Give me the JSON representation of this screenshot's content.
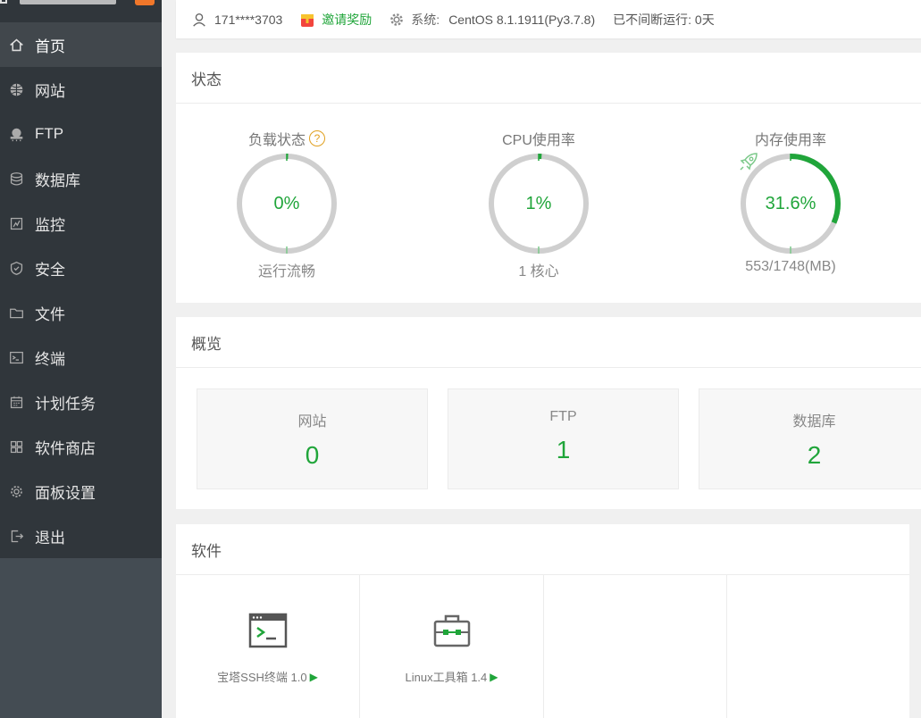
{
  "sidebar": {
    "items": [
      {
        "label": "首页",
        "icon": "home-icon"
      },
      {
        "label": "网站",
        "icon": "globe-icon"
      },
      {
        "label": "FTP",
        "icon": "ftp-icon"
      },
      {
        "label": "数据库",
        "icon": "database-icon"
      },
      {
        "label": "监控",
        "icon": "monitor-icon"
      },
      {
        "label": "安全",
        "icon": "shield-icon"
      },
      {
        "label": "文件",
        "icon": "folder-icon"
      },
      {
        "label": "终端",
        "icon": "terminal-icon"
      },
      {
        "label": "计划任务",
        "icon": "calendar-icon"
      },
      {
        "label": "软件商店",
        "icon": "grid-icon"
      },
      {
        "label": "面板设置",
        "icon": "gear-icon"
      },
      {
        "label": "退出",
        "icon": "logout-icon"
      }
    ]
  },
  "topbar": {
    "user": "171****3703",
    "invite": "邀请奖励",
    "system_label": "系统:",
    "system_value": "CentOS 8.1.1911(Py3.7.8)",
    "uptime": "已不间断运行: 0天"
  },
  "status": {
    "title": "状态",
    "load": {
      "title": "负载状态",
      "help": "?",
      "value": "0%",
      "sub": "运行流畅",
      "fraction": 0
    },
    "cpu": {
      "title": "CPU使用率",
      "value": "1%",
      "sub": "1 核心",
      "fraction": 0.01
    },
    "memory": {
      "title": "内存使用率",
      "value": "31.6%",
      "sub": "553/1748(MB)",
      "fraction": 0.316
    }
  },
  "overview": {
    "title": "概览",
    "cards": [
      {
        "label": "网站",
        "value": "0"
      },
      {
        "label": "FTP",
        "value": "1"
      },
      {
        "label": "数据库",
        "value": "2"
      }
    ]
  },
  "software": {
    "title": "软件",
    "items": [
      {
        "name": "宝塔SSH终端 1.0",
        "icon": "terminal-window-icon"
      },
      {
        "name": "Linux工具箱 1.4",
        "icon": "toolbox-icon"
      }
    ]
  },
  "colors": {
    "accent": "#20a53a",
    "sidebar": "#30363b",
    "ring": "#cfcfcf"
  }
}
